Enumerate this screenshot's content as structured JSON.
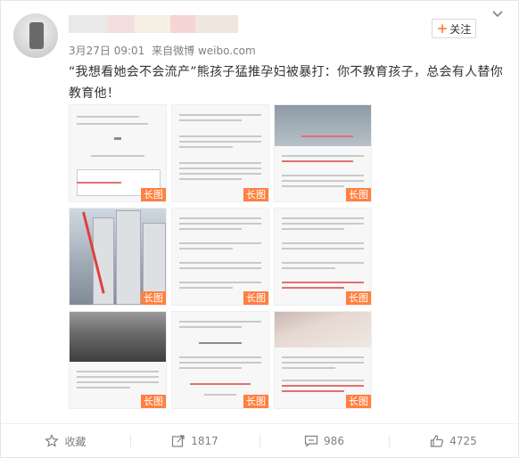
{
  "header": {
    "date": "3月27日 09:01",
    "source_prefix": "来自",
    "source": "微博 weibo.com",
    "follow_label": "关注",
    "follow_plus": "+"
  },
  "post": {
    "text": "“我想看她会不会流产”熊孩子猛推孕妇被暴打：你不教育孩子，总会有人替你教育他！"
  },
  "images": {
    "tag_label": "长图",
    "count": 9
  },
  "actions": {
    "collect_label": "收藏",
    "share_count": "1817",
    "comment_count": "986",
    "like_count": "4725"
  },
  "colors": {
    "accent_orange": "#ff8140",
    "tag_bg": "#ff8040",
    "meta_gray": "#808080"
  }
}
